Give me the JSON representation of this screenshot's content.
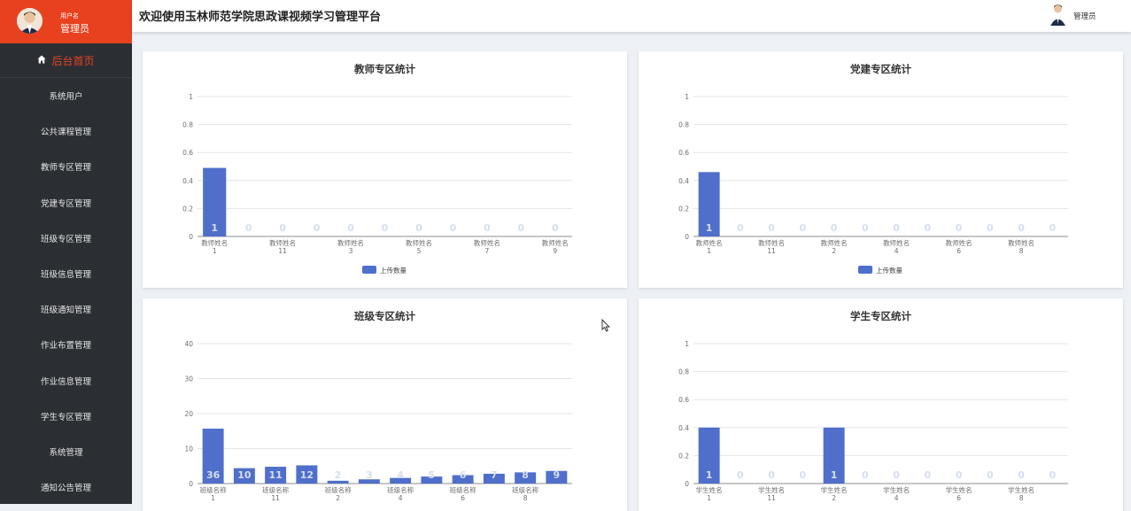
{
  "sidebar": {
    "user_caption": "用户名",
    "user_name": "管理员",
    "home": {
      "label": "后台首页",
      "icon": "home-icon"
    },
    "items": [
      "系统用户",
      "公共课程管理",
      "教师专区管理",
      "党建专区管理",
      "班级专区管理",
      "班级信息管理",
      "班级通知管理",
      "作业布置管理",
      "作业信息管理",
      "学生专区管理",
      "系统管理",
      "通知公告管理"
    ]
  },
  "header": {
    "title": "欢迎使用玉林师范学院思政课视频学习管理平台",
    "user": "管理员"
  },
  "colors": {
    "sidebar_bg": "#2b2f33",
    "accent": "#e8411f",
    "bar": "#4f6fcb"
  },
  "charts": [
    {
      "title": "教师专区统计",
      "chart_data": {
        "type": "bar",
        "title": "教师专区统计",
        "ylim": [
          0,
          1
        ],
        "yticks": [
          "0",
          "0.2",
          "0.4",
          "0.6",
          "0.8",
          "1"
        ],
        "tick_labels": [
          [
            "教师姓名",
            "1"
          ],
          [
            "教师姓名",
            "11"
          ],
          [
            "教师姓名",
            "3"
          ],
          [
            "教师姓名",
            "5"
          ],
          [
            "教师姓名",
            "7"
          ],
          [
            "教师姓名",
            "9"
          ]
        ],
        "values": [
          0.49,
          0,
          0,
          0,
          0,
          0,
          0,
          0,
          0,
          0,
          0
        ],
        "data_labels": [
          "1",
          "0",
          "0",
          "0",
          "0",
          "0",
          "0",
          "0",
          "0",
          "0",
          "0"
        ],
        "legend": "上传数量"
      }
    },
    {
      "title": "党建专区统计",
      "chart_data": {
        "type": "bar",
        "title": "党建专区统计",
        "ylim": [
          0,
          1
        ],
        "yticks": [
          "0",
          "0.2",
          "0.4",
          "0.6",
          "0.8",
          "1"
        ],
        "tick_labels": [
          [
            "教师姓名",
            "1"
          ],
          [
            "教师姓名",
            "11"
          ],
          [
            "教师姓名",
            "2"
          ],
          [
            "教师姓名",
            "4"
          ],
          [
            "教师姓名",
            "6"
          ],
          [
            "教师姓名",
            "8"
          ]
        ],
        "values": [
          0.46,
          0,
          0,
          0,
          0,
          0,
          0,
          0,
          0,
          0,
          0,
          0
        ],
        "data_labels": [
          "1",
          "0",
          "0",
          "0",
          "0",
          "0",
          "0",
          "0",
          "0",
          "0",
          "0",
          "0"
        ],
        "legend": "上传数量"
      }
    },
    {
      "title": "班级专区统计",
      "chart_data": {
        "type": "bar",
        "title": "班级专区统计",
        "ylim": [
          0,
          40
        ],
        "yticks": [
          "0",
          "10",
          "20",
          "30",
          "40"
        ],
        "tick_labels": [
          [
            "班级名称",
            "1"
          ],
          [
            "班级名称",
            "11"
          ],
          [
            "班级名称",
            "2"
          ],
          [
            "班级名称",
            "4"
          ],
          [
            "班级名称",
            "6"
          ],
          [
            "班级名称",
            "8"
          ]
        ],
        "values": [
          15.7,
          4.4,
          4.8,
          5.2,
          0.8,
          1.2,
          1.6,
          2.0,
          2.4,
          2.8,
          3.2,
          3.6
        ],
        "data_labels": [
          "36",
          "10",
          "11",
          "12",
          "2",
          "3",
          "4",
          "5",
          "6",
          "7",
          "8",
          "9"
        ]
      }
    },
    {
      "title": "学生专区统计",
      "chart_data": {
        "type": "bar",
        "title": "学生专区统计",
        "ylim": [
          0,
          1
        ],
        "yticks": [
          "0",
          "0.2",
          "0.4",
          "0.6",
          "0.8",
          "1"
        ],
        "tick_labels": [
          [
            "学生姓名",
            "1"
          ],
          [
            "学生姓名",
            "11"
          ],
          [
            "学生姓名",
            "2"
          ],
          [
            "学生姓名",
            "4"
          ],
          [
            "学生姓名",
            "6"
          ],
          [
            "学生姓名",
            "8"
          ]
        ],
        "values": [
          0.4,
          0,
          0,
          0,
          0.4,
          0,
          0,
          0,
          0,
          0,
          0,
          0
        ],
        "data_labels": [
          "1",
          "0",
          "0",
          "0",
          "1",
          "0",
          "0",
          "0",
          "0",
          "0",
          "0",
          "0"
        ]
      }
    }
  ]
}
